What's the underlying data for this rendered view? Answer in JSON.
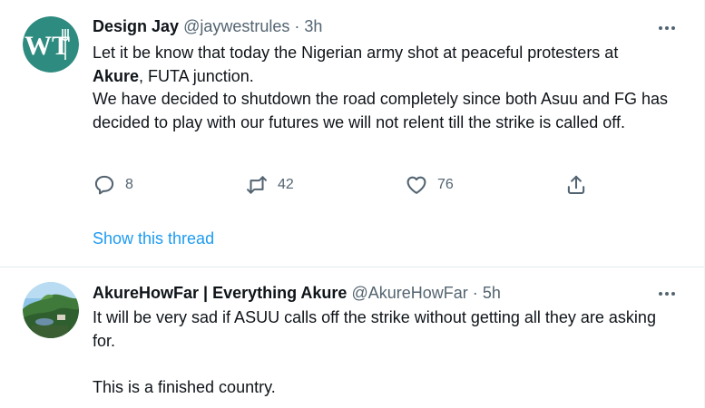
{
  "tweets": [
    {
      "name": "Design Jay",
      "handle": "@jaywestrules",
      "separator": "·",
      "time": "3h",
      "avatar_initials": "WT",
      "text": {
        "l1": "Let it be know that today the Nigerian army shot at peaceful protesters at",
        "l2_bold": "Akure",
        "l2_rest": ", FUTA junction.",
        "l3": "We have decided to shutdown the road completely since both Asuu and FG has decided to play with our futures we will not relent till the strike is called off."
      },
      "replies": "8",
      "retweets": "42",
      "likes": "76",
      "show_thread": "Show this thread"
    },
    {
      "name": "AkureHowFar | Everything Akure",
      "handle": "@AkureHowFar",
      "separator": "·",
      "time": "5h",
      "text": {
        "p1": "It will be very sad if ASUU calls off the strike without getting all they are asking for.",
        "p2": "This is a finished country."
      }
    }
  ],
  "icons": {
    "more": "more-horizontal-icon",
    "reply": "reply-icon",
    "retweet": "retweet-icon",
    "like": "heart-icon",
    "share": "share-icon"
  },
  "colors": {
    "text": "#0f1419",
    "secondary": "#536471",
    "link": "#1d9bf0",
    "divider": "#e6ecf0",
    "avatar1": "#2e8b80"
  }
}
